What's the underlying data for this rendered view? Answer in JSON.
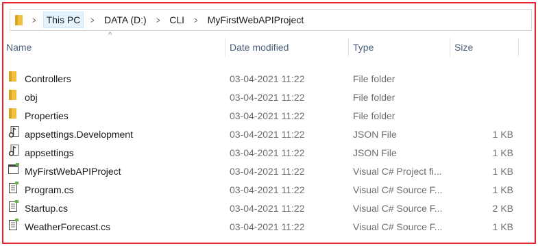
{
  "breadcrumb": [
    "This PC",
    "DATA (D:)",
    "CLI",
    "MyFirstWebAPIProject"
  ],
  "columns": {
    "name": "Name",
    "date": "Date modified",
    "type": "Type",
    "size": "Size"
  },
  "sort_indicator": "^",
  "files": [
    {
      "name": "Controllers",
      "date": "03-04-2021 11:22",
      "type": "File folder",
      "size": "",
      "icon": "folder-icon"
    },
    {
      "name": "obj",
      "date": "03-04-2021 11:22",
      "type": "File folder",
      "size": "",
      "icon": "folder-icon"
    },
    {
      "name": "Properties",
      "date": "03-04-2021 11:22",
      "type": "File folder",
      "size": "",
      "icon": "folder-icon"
    },
    {
      "name": "appsettings.Development",
      "date": "03-04-2021 11:22",
      "type": "JSON File",
      "size": "1 KB",
      "icon": "json-file-icon"
    },
    {
      "name": "appsettings",
      "date": "03-04-2021 11:22",
      "type": "JSON File",
      "size": "1 KB",
      "icon": "json-file-icon"
    },
    {
      "name": "MyFirstWebAPIProject",
      "date": "03-04-2021 11:22",
      "type": "Visual C# Project fi...",
      "size": "1 KB",
      "icon": "csproj-file-icon"
    },
    {
      "name": "Program.cs",
      "date": "03-04-2021 11:22",
      "type": "Visual C# Source F...",
      "size": "1 KB",
      "icon": "cs-file-icon"
    },
    {
      "name": "Startup.cs",
      "date": "03-04-2021 11:22",
      "type": "Visual C# Source F...",
      "size": "2 KB",
      "icon": "cs-file-icon"
    },
    {
      "name": "WeatherForecast.cs",
      "date": "03-04-2021 11:22",
      "type": "Visual C# Source F...",
      "size": "1 KB",
      "icon": "cs-file-icon"
    }
  ],
  "colors": {
    "frame": "#e8202a",
    "folder": "#f0c040",
    "header_text": "#4c607a",
    "secondary_text": "#6d6d6d"
  }
}
